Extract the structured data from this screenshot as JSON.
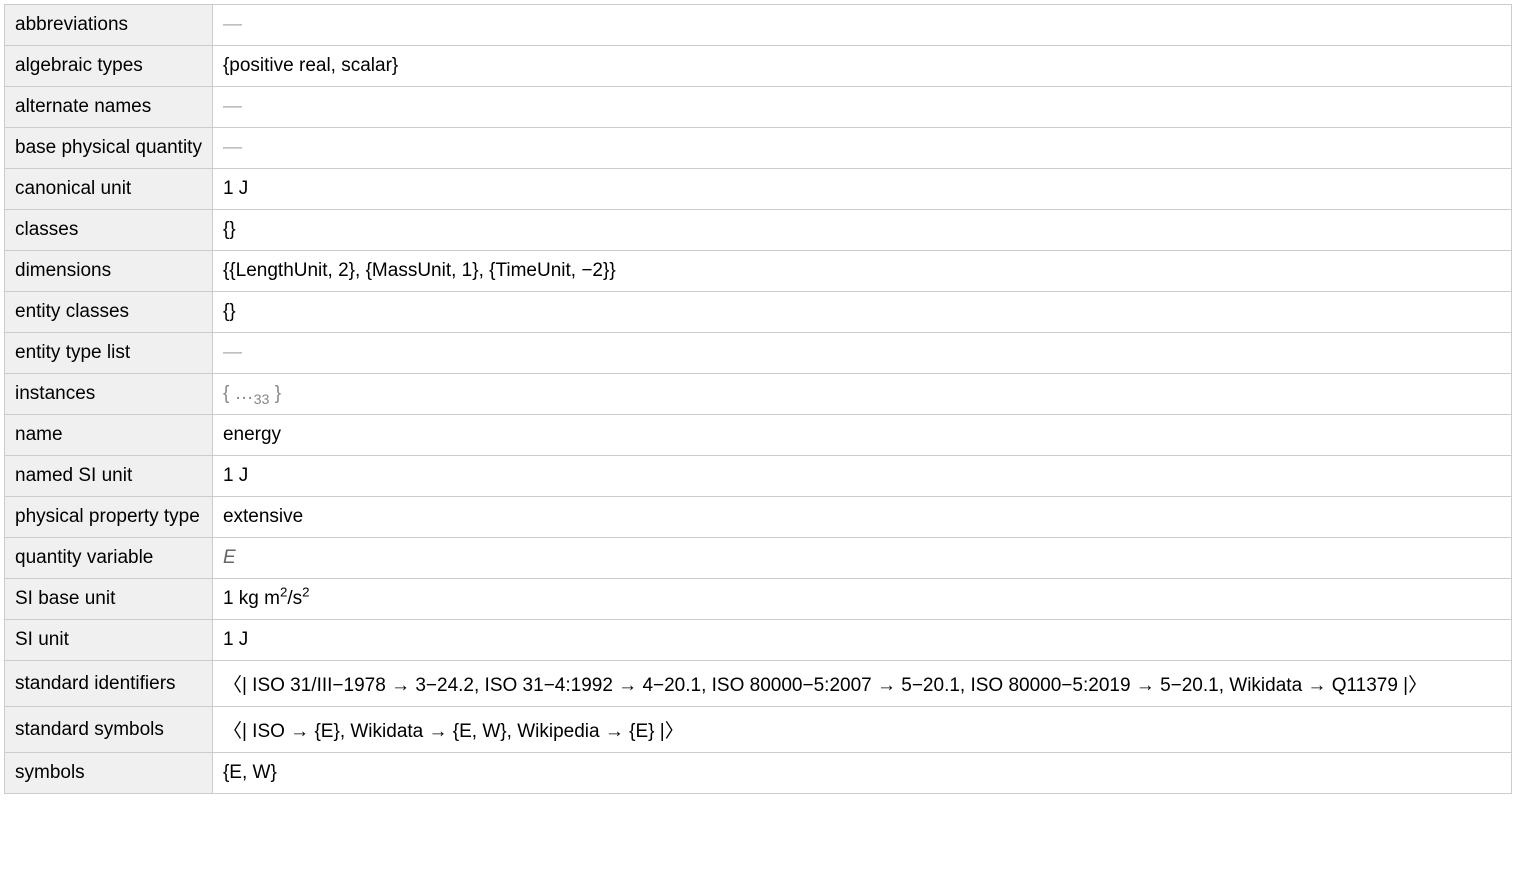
{
  "rows": [
    {
      "label": "abbreviations",
      "value": "—",
      "style": "dash"
    },
    {
      "label": "algebraic types",
      "value": "{positive real, scalar}",
      "style": "plain"
    },
    {
      "label": "alternate names",
      "value": "—",
      "style": "dash"
    },
    {
      "label": "base physical quantity",
      "value": "—",
      "style": "dash"
    },
    {
      "label": "canonical unit",
      "value": "1 J",
      "style": "plain"
    },
    {
      "label": "classes",
      "value": "{}",
      "style": "plain"
    },
    {
      "label": "dimensions",
      "value": "{{LengthUnit, 2}, {MassUnit, 1}, {TimeUnit, −2}}",
      "style": "plain"
    },
    {
      "label": "entity classes",
      "value": "{}",
      "style": "plain"
    },
    {
      "label": "entity type list",
      "value": "—",
      "style": "dash"
    },
    {
      "label": "instances",
      "value": "instances_special",
      "style": "instances"
    },
    {
      "label": "name",
      "value": "energy",
      "style": "plain"
    },
    {
      "label": "named SI unit",
      "value": "1 J",
      "style": "plain"
    },
    {
      "label": "physical property type",
      "value": "extensive",
      "style": "plain"
    },
    {
      "label": "quantity variable",
      "value": "E",
      "style": "italic"
    },
    {
      "label": "SI base unit",
      "value": "si_base_special",
      "style": "sibase"
    },
    {
      "label": "SI unit",
      "value": "1 J",
      "style": "plain"
    },
    {
      "label": "standard identifiers",
      "value": "〈| ISO 31/III−1978 → 3−24.2, ISO 31−4:1992 → 4−20.1, ISO 80000−5:2007 → 5−20.1, ISO 80000−5:2019 → 5−20.1, Wikidata → Q11379 |〉",
      "style": "plain"
    },
    {
      "label": "standard symbols",
      "value": "〈| ISO → {E}, Wikidata → {E, W}, Wikipedia → {E} |〉",
      "style": "plain"
    },
    {
      "label": "symbols",
      "value": "{E, W}",
      "style": "plain"
    }
  ],
  "instances": {
    "open": "{ ",
    "ellipsis": "…",
    "count": "33",
    "close": " }"
  },
  "sibase": {
    "prefix": "1 kg m",
    "exp1": "2",
    "mid": "/s",
    "exp2": "2"
  }
}
